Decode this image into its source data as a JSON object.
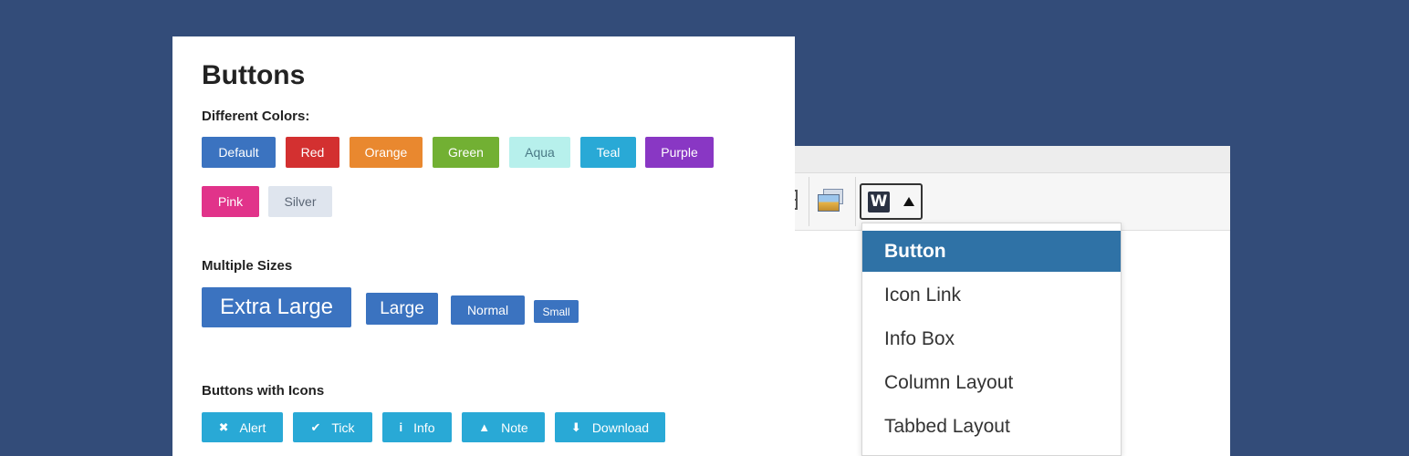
{
  "colors": {
    "background": "#334c79",
    "default": "#3b73c0",
    "red": "#d33030",
    "orange": "#e9882f",
    "green": "#72b033",
    "aqua": "#b7f0ec",
    "teal": "#29a9d6",
    "purple": "#8937c4",
    "pink": "#e1338a",
    "silver": "#dfe5ee",
    "dropdown_active": "#2f72a6"
  },
  "panel": {
    "title": "Buttons",
    "sections": {
      "colors_heading": "Different Colors:",
      "sizes_heading": "Multiple Sizes",
      "icons_heading": "Buttons with Icons"
    },
    "color_buttons": [
      {
        "label": "Default",
        "color": "default"
      },
      {
        "label": "Red",
        "color": "red"
      },
      {
        "label": "Orange",
        "color": "orange"
      },
      {
        "label": "Green",
        "color": "green"
      },
      {
        "label": "Aqua",
        "color": "aqua"
      },
      {
        "label": "Teal",
        "color": "teal"
      },
      {
        "label": "Purple",
        "color": "purple"
      },
      {
        "label": "Pink",
        "color": "pink"
      },
      {
        "label": "Silver",
        "color": "silver"
      }
    ],
    "size_buttons": [
      {
        "label": "Extra Large",
        "size": "extra-large"
      },
      {
        "label": "Large",
        "size": "large"
      },
      {
        "label": "Normal",
        "size": "normal"
      },
      {
        "label": "Small",
        "size": "small"
      }
    ],
    "icon_buttons": [
      {
        "label": "Alert",
        "icon": "x-icon",
        "glyph": "✖"
      },
      {
        "label": "Tick",
        "icon": "check-icon",
        "glyph": "✔"
      },
      {
        "label": "Info",
        "icon": "info-icon",
        "glyph": "i"
      },
      {
        "label": "Note",
        "icon": "warning-icon",
        "glyph": "▲"
      },
      {
        "label": "Download",
        "icon": "download-icon",
        "glyph": "⬇"
      }
    ]
  },
  "editor": {
    "toolbar": {
      "icons": [
        "table-icon",
        "media-icon",
        "w-plugin-icon",
        "triangle-up-icon"
      ],
      "plugin_logo": "W"
    },
    "dropdown": {
      "items": [
        {
          "label": "Button",
          "active": true
        },
        {
          "label": "Icon Link",
          "active": false
        },
        {
          "label": "Info Box",
          "active": false
        },
        {
          "label": "Column Layout",
          "active": false
        },
        {
          "label": "Tabbed Layout",
          "active": false
        }
      ]
    }
  }
}
